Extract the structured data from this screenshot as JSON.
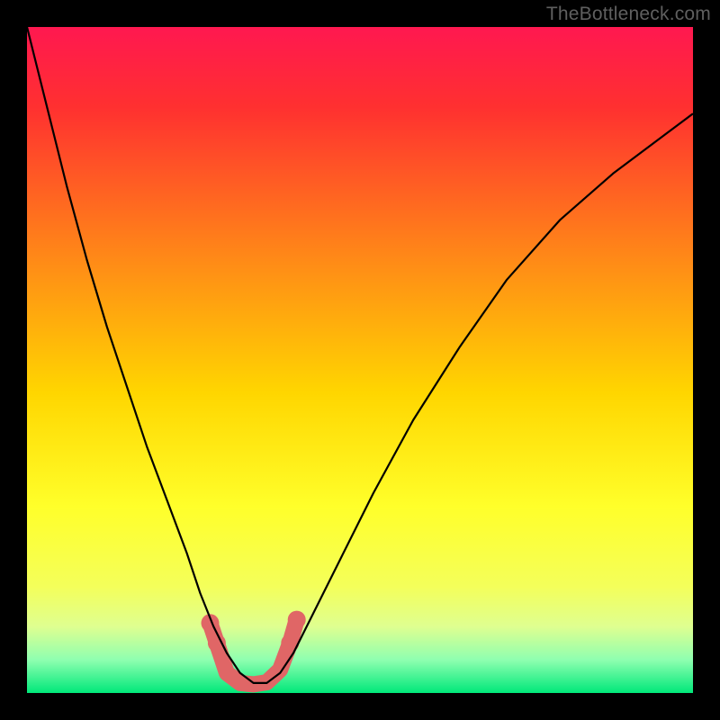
{
  "watermark": "TheBottleneck.com",
  "chart_data": {
    "type": "line",
    "title": "",
    "xlabel": "",
    "ylabel": "",
    "xlim": [
      0,
      100
    ],
    "ylim": [
      0,
      100
    ],
    "background_gradient": {
      "stops": [
        {
          "offset": 0.0,
          "color": "#ff1850"
        },
        {
          "offset": 0.12,
          "color": "#ff3030"
        },
        {
          "offset": 0.35,
          "color": "#ff8a17"
        },
        {
          "offset": 0.55,
          "color": "#ffd600"
        },
        {
          "offset": 0.72,
          "color": "#ffff2a"
        },
        {
          "offset": 0.84,
          "color": "#f4ff5a"
        },
        {
          "offset": 0.9,
          "color": "#dfff90"
        },
        {
          "offset": 0.95,
          "color": "#8fffb0"
        },
        {
          "offset": 1.0,
          "color": "#00e87a"
        }
      ]
    },
    "series": [
      {
        "name": "bottleneck-curve",
        "stroke": "#000000",
        "stroke_width": 2.2,
        "x": [
          0,
          3,
          6,
          9,
          12,
          15,
          18,
          21,
          24,
          26,
          28,
          30,
          32,
          34,
          36,
          38,
          40,
          43,
          47,
          52,
          58,
          65,
          72,
          80,
          88,
          96,
          100
        ],
        "y": [
          100,
          88,
          76,
          65,
          55,
          46,
          37,
          29,
          21,
          15,
          10,
          6,
          3,
          1.5,
          1.5,
          3,
          6,
          12,
          20,
          30,
          41,
          52,
          62,
          71,
          78,
          84,
          87
        ]
      }
    ],
    "markers": {
      "name": "highlight-segment",
      "color": "#e06666",
      "radius": 9,
      "points": [
        {
          "x": 27.5,
          "y": 10.5
        },
        {
          "x": 28.5,
          "y": 7.5
        },
        {
          "x": 30.0,
          "y": 3.0
        },
        {
          "x": 32.0,
          "y": 1.5
        },
        {
          "x": 34.0,
          "y": 1.3
        },
        {
          "x": 36.0,
          "y": 1.6
        },
        {
          "x": 38.0,
          "y": 3.5
        },
        {
          "x": 39.5,
          "y": 7.5
        },
        {
          "x": 40.5,
          "y": 11.0
        }
      ]
    }
  }
}
